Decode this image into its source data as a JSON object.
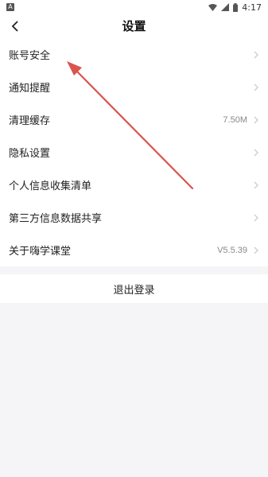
{
  "status_bar": {
    "notification_icon_letter": "A",
    "time": "4:17",
    "icons": [
      "wifi-icon",
      "signal-icon",
      "battery-icon"
    ]
  },
  "header": {
    "title": "设置",
    "back_icon": "chevron-left-icon"
  },
  "settings": {
    "items": [
      {
        "label": "账号安全",
        "value": ""
      },
      {
        "label": "通知提醒",
        "value": ""
      },
      {
        "label": "清理缓存",
        "value": "7.50M"
      },
      {
        "label": "隐私设置",
        "value": ""
      },
      {
        "label": "个人信息收集清单",
        "value": ""
      },
      {
        "label": "第三方信息数据共享",
        "value": ""
      },
      {
        "label": "关于嗨学课堂",
        "value": "V5.5.39"
      }
    ]
  },
  "logout": {
    "label": "退出登录"
  },
  "annotation": {
    "type": "arrow",
    "color": "#d9534f",
    "points_to": "账号安全"
  }
}
